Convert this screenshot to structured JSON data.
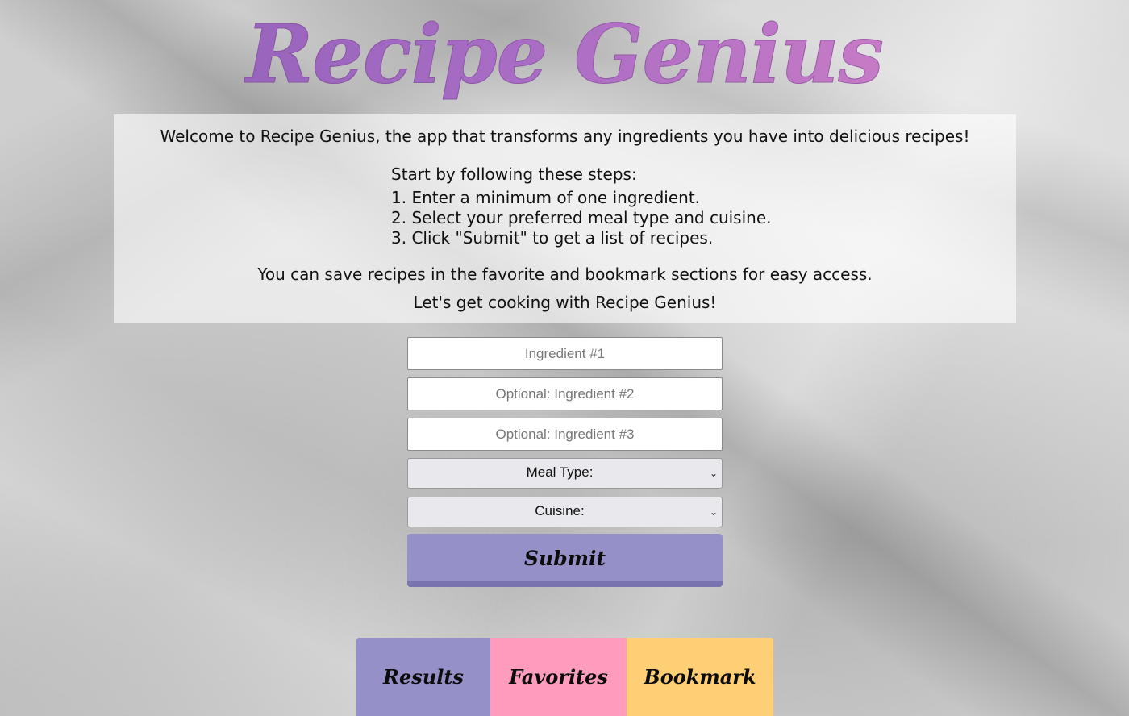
{
  "header": {
    "title": "Recipe Genius"
  },
  "intro": {
    "welcome": "Welcome to Recipe Genius, the app that transforms any ingredients you have into delicious recipes!",
    "steps_heading": "Start by following these steps:",
    "steps": [
      "1. Enter a minimum of one ingredient.",
      "2. Select your preferred meal type and cuisine.",
      "3. Click \"Submit\" to get a list of recipes."
    ],
    "save_note": "You can save recipes in the favorite and bookmark sections for easy access.",
    "cook_note": "Let's get cooking with Recipe Genius!"
  },
  "form": {
    "ingredient1": {
      "placeholder": "Ingredient #1",
      "value": ""
    },
    "ingredient2": {
      "placeholder": "Optional: Ingredient #2",
      "value": ""
    },
    "ingredient3": {
      "placeholder": "Optional: Ingredient #3",
      "value": ""
    },
    "meal_type": {
      "selected": "Meal Type:"
    },
    "cuisine": {
      "selected": "Cuisine:"
    },
    "submit_label": "Submit"
  },
  "tabs": [
    {
      "label": "Results",
      "color": "#9591c8"
    },
    {
      "label": "Favorites",
      "color": "#ff9bbd"
    },
    {
      "label": "Bookmark",
      "color": "#ffcf75"
    }
  ],
  "icons": {
    "dropdown": "chevron-down-icon"
  }
}
